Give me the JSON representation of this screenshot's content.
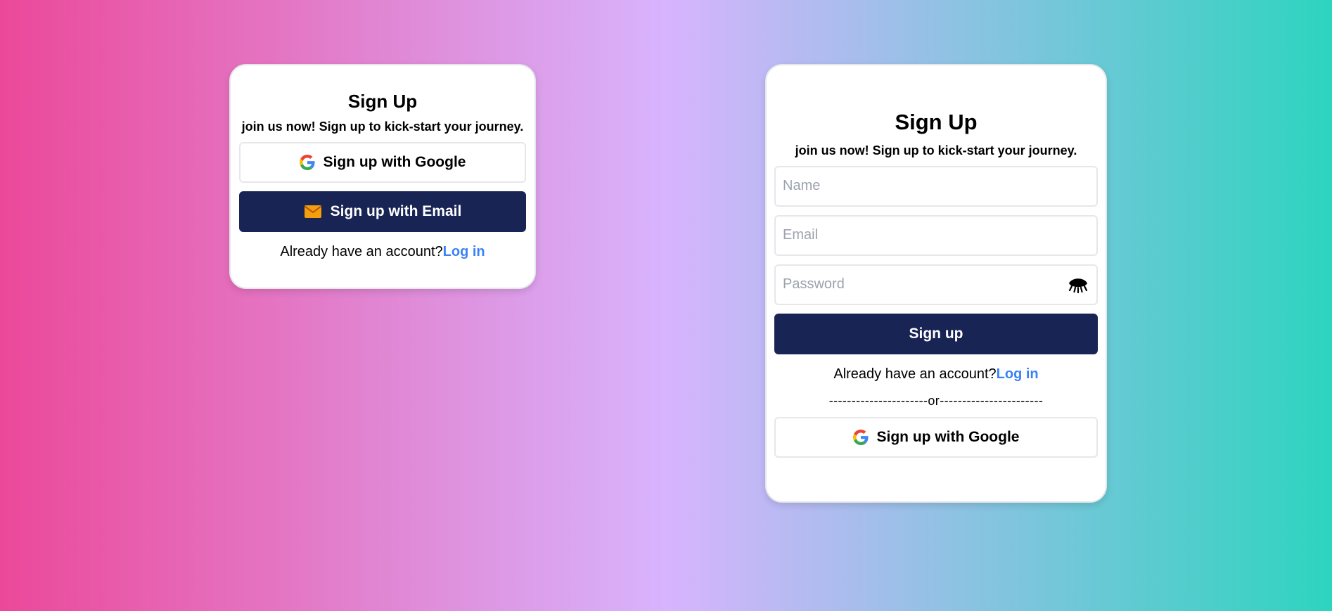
{
  "left_card": {
    "title": "Sign Up",
    "subtitle": "join us now! Sign up to kick-start your journey.",
    "google_button_label": "Sign up with Google",
    "email_button_label": "Sign up with Email",
    "account_prompt": "Already have an account?",
    "login_link": "Log in"
  },
  "right_card": {
    "title": "Sign Up",
    "subtitle": "join us now! Sign up to kick-start your journey.",
    "name_placeholder": "Name",
    "email_placeholder": "Email",
    "password_placeholder": "Password",
    "submit_label": "Sign up",
    "account_prompt": "Already have an account?",
    "login_link": "Log in",
    "divider_text": "----------------------or-----------------------",
    "google_button_label": "Sign up with Google"
  },
  "icons": {
    "google": "google-icon",
    "email": "envelope-icon",
    "password_toggle": "eye-closed-icon"
  },
  "colors": {
    "primary_button": "#182454",
    "link": "#3b82f6",
    "gradient_start": "#ec4899",
    "gradient_mid": "#d8b4fe",
    "gradient_end": "#2dd4bf"
  }
}
